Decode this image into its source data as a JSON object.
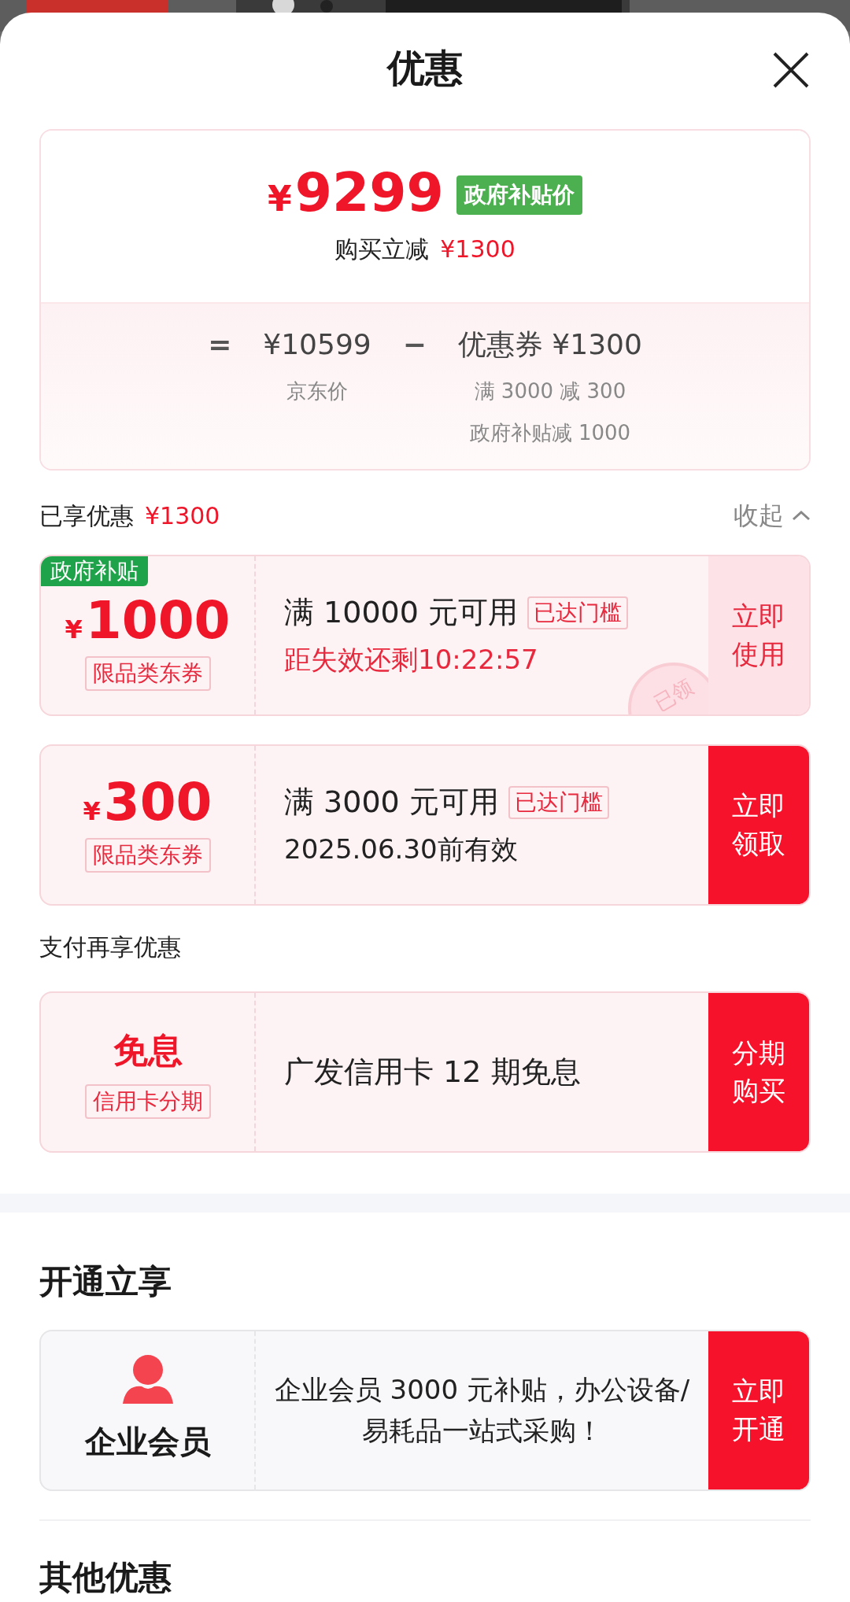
{
  "sheet": {
    "title": "优惠"
  },
  "price_card": {
    "currency": "¥",
    "price": "9299",
    "price_badge": "政府补贴价",
    "saving_label": "购买立减",
    "saving_amount": "¥1300",
    "formula": [
      {
        "kind": "operator",
        "text": "="
      },
      {
        "kind": "term",
        "text": "¥10599",
        "notes": [
          "京东价"
        ]
      },
      {
        "kind": "operator",
        "text": "−"
      },
      {
        "kind": "term",
        "text": "优惠券 ¥1300",
        "notes": [
          "满 3000 减 300",
          "政府补贴减 1000"
        ]
      }
    ]
  },
  "applied": {
    "label": "已享优惠",
    "amount": "¥1300",
    "toggle": "收起",
    "expanded": true
  },
  "coupons": [
    {
      "tag": "政府补贴",
      "currency": "¥",
      "amount": "1000",
      "label": "限品类东券",
      "condition": "满 10000 元可用",
      "badge": "已达门槛",
      "detail": "距失效还剩10:22:57",
      "kind": "countdown",
      "claimed": true,
      "stamp": "已领",
      "button": "立即使用"
    },
    {
      "currency": "¥",
      "amount": "300",
      "label": "限品类东券",
      "condition": "满 3000 元可用",
      "badge": "已达门槛",
      "detail": "2025.06.30前有效",
      "kind": "validity",
      "claimed": false,
      "button": "立即领取"
    }
  ],
  "payment": {
    "heading": "支付再享优惠",
    "offer": {
      "title": "免息",
      "label": "信用卡分期",
      "text": "广发信用卡 12 期免息",
      "button": "分期购买"
    }
  },
  "membership": {
    "heading": "开通立享",
    "offer": {
      "name": "企业会员",
      "text": "企业会员 3000 元补贴，办公设备/易耗品一站式采购！",
      "button": "立即开通"
    }
  },
  "other": {
    "heading": "其他优惠"
  }
}
